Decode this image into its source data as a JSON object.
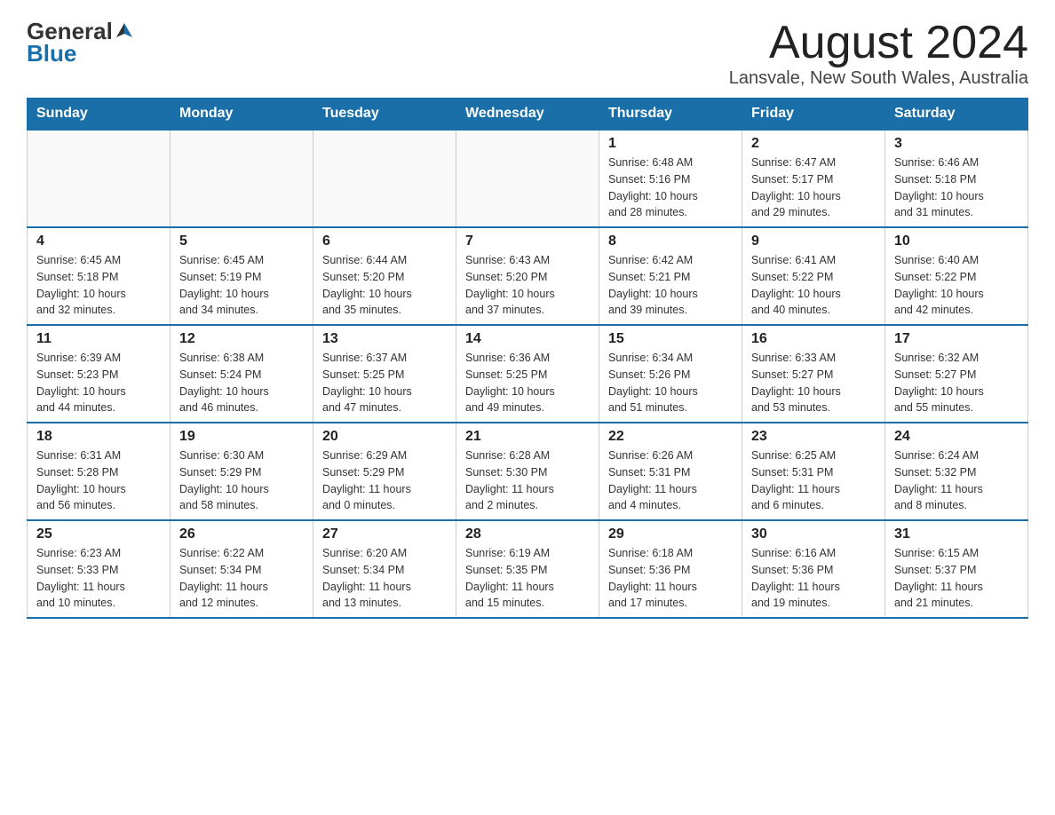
{
  "header": {
    "logo_general": "General",
    "logo_blue": "Blue",
    "month_title": "August 2024",
    "location": "Lansvale, New South Wales, Australia"
  },
  "weekdays": [
    "Sunday",
    "Monday",
    "Tuesday",
    "Wednesday",
    "Thursday",
    "Friday",
    "Saturday"
  ],
  "weeks": [
    [
      {
        "day": "",
        "info": ""
      },
      {
        "day": "",
        "info": ""
      },
      {
        "day": "",
        "info": ""
      },
      {
        "day": "",
        "info": ""
      },
      {
        "day": "1",
        "info": "Sunrise: 6:48 AM\nSunset: 5:16 PM\nDaylight: 10 hours\nand 28 minutes."
      },
      {
        "day": "2",
        "info": "Sunrise: 6:47 AM\nSunset: 5:17 PM\nDaylight: 10 hours\nand 29 minutes."
      },
      {
        "day": "3",
        "info": "Sunrise: 6:46 AM\nSunset: 5:18 PM\nDaylight: 10 hours\nand 31 minutes."
      }
    ],
    [
      {
        "day": "4",
        "info": "Sunrise: 6:45 AM\nSunset: 5:18 PM\nDaylight: 10 hours\nand 32 minutes."
      },
      {
        "day": "5",
        "info": "Sunrise: 6:45 AM\nSunset: 5:19 PM\nDaylight: 10 hours\nand 34 minutes."
      },
      {
        "day": "6",
        "info": "Sunrise: 6:44 AM\nSunset: 5:20 PM\nDaylight: 10 hours\nand 35 minutes."
      },
      {
        "day": "7",
        "info": "Sunrise: 6:43 AM\nSunset: 5:20 PM\nDaylight: 10 hours\nand 37 minutes."
      },
      {
        "day": "8",
        "info": "Sunrise: 6:42 AM\nSunset: 5:21 PM\nDaylight: 10 hours\nand 39 minutes."
      },
      {
        "day": "9",
        "info": "Sunrise: 6:41 AM\nSunset: 5:22 PM\nDaylight: 10 hours\nand 40 minutes."
      },
      {
        "day": "10",
        "info": "Sunrise: 6:40 AM\nSunset: 5:22 PM\nDaylight: 10 hours\nand 42 minutes."
      }
    ],
    [
      {
        "day": "11",
        "info": "Sunrise: 6:39 AM\nSunset: 5:23 PM\nDaylight: 10 hours\nand 44 minutes."
      },
      {
        "day": "12",
        "info": "Sunrise: 6:38 AM\nSunset: 5:24 PM\nDaylight: 10 hours\nand 46 minutes."
      },
      {
        "day": "13",
        "info": "Sunrise: 6:37 AM\nSunset: 5:25 PM\nDaylight: 10 hours\nand 47 minutes."
      },
      {
        "day": "14",
        "info": "Sunrise: 6:36 AM\nSunset: 5:25 PM\nDaylight: 10 hours\nand 49 minutes."
      },
      {
        "day": "15",
        "info": "Sunrise: 6:34 AM\nSunset: 5:26 PM\nDaylight: 10 hours\nand 51 minutes."
      },
      {
        "day": "16",
        "info": "Sunrise: 6:33 AM\nSunset: 5:27 PM\nDaylight: 10 hours\nand 53 minutes."
      },
      {
        "day": "17",
        "info": "Sunrise: 6:32 AM\nSunset: 5:27 PM\nDaylight: 10 hours\nand 55 minutes."
      }
    ],
    [
      {
        "day": "18",
        "info": "Sunrise: 6:31 AM\nSunset: 5:28 PM\nDaylight: 10 hours\nand 56 minutes."
      },
      {
        "day": "19",
        "info": "Sunrise: 6:30 AM\nSunset: 5:29 PM\nDaylight: 10 hours\nand 58 minutes."
      },
      {
        "day": "20",
        "info": "Sunrise: 6:29 AM\nSunset: 5:29 PM\nDaylight: 11 hours\nand 0 minutes."
      },
      {
        "day": "21",
        "info": "Sunrise: 6:28 AM\nSunset: 5:30 PM\nDaylight: 11 hours\nand 2 minutes."
      },
      {
        "day": "22",
        "info": "Sunrise: 6:26 AM\nSunset: 5:31 PM\nDaylight: 11 hours\nand 4 minutes."
      },
      {
        "day": "23",
        "info": "Sunrise: 6:25 AM\nSunset: 5:31 PM\nDaylight: 11 hours\nand 6 minutes."
      },
      {
        "day": "24",
        "info": "Sunrise: 6:24 AM\nSunset: 5:32 PM\nDaylight: 11 hours\nand 8 minutes."
      }
    ],
    [
      {
        "day": "25",
        "info": "Sunrise: 6:23 AM\nSunset: 5:33 PM\nDaylight: 11 hours\nand 10 minutes."
      },
      {
        "day": "26",
        "info": "Sunrise: 6:22 AM\nSunset: 5:34 PM\nDaylight: 11 hours\nand 12 minutes."
      },
      {
        "day": "27",
        "info": "Sunrise: 6:20 AM\nSunset: 5:34 PM\nDaylight: 11 hours\nand 13 minutes."
      },
      {
        "day": "28",
        "info": "Sunrise: 6:19 AM\nSunset: 5:35 PM\nDaylight: 11 hours\nand 15 minutes."
      },
      {
        "day": "29",
        "info": "Sunrise: 6:18 AM\nSunset: 5:36 PM\nDaylight: 11 hours\nand 17 minutes."
      },
      {
        "day": "30",
        "info": "Sunrise: 6:16 AM\nSunset: 5:36 PM\nDaylight: 11 hours\nand 19 minutes."
      },
      {
        "day": "31",
        "info": "Sunrise: 6:15 AM\nSunset: 5:37 PM\nDaylight: 11 hours\nand 21 minutes."
      }
    ]
  ]
}
